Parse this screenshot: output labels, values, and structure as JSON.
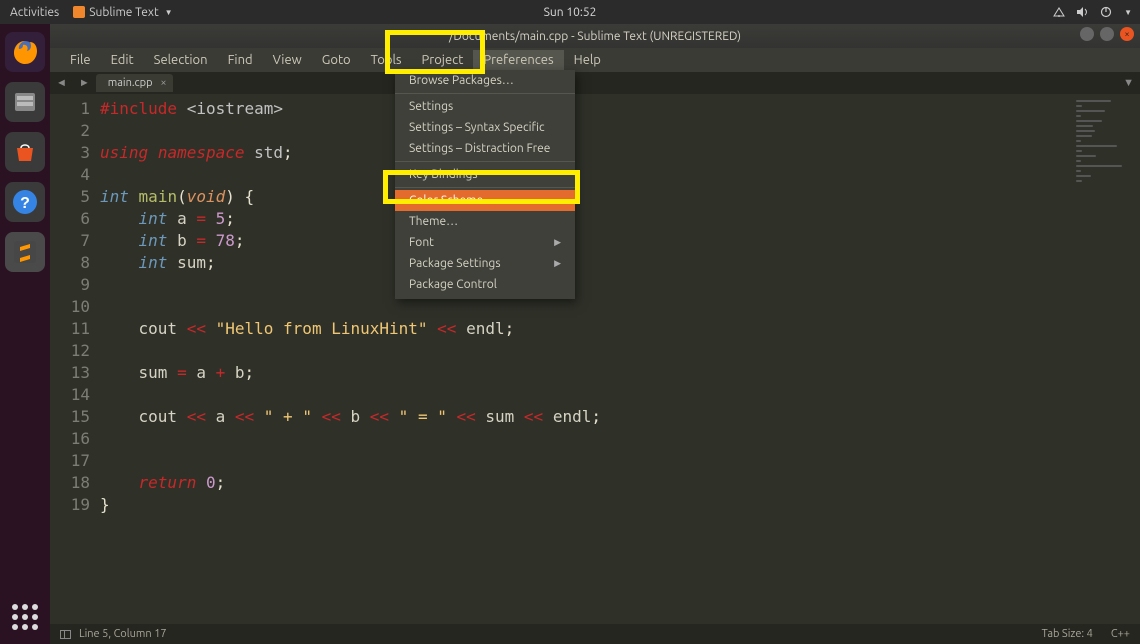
{
  "gnome": {
    "activities": "Activities",
    "app_name": "Sublime Text",
    "clock": "Sun 10:52",
    "net_icon": "network-icon",
    "sound_icon": "sound-icon",
    "power_icon": "power-icon"
  },
  "launcher": {
    "firefox": "🦊",
    "files": "🗄",
    "store": "🛍",
    "help": "?",
    "sublime": "S"
  },
  "window": {
    "title": "/Documents/main.cpp - Sublime Text (UNREGISTERED)"
  },
  "menubar": {
    "items": [
      "File",
      "Edit",
      "Selection",
      "Find",
      "View",
      "Goto",
      "Tools",
      "Project",
      "Preferences",
      "Help"
    ],
    "active_index": 8
  },
  "tabs": {
    "back": "◄",
    "fwd": "►",
    "file": "main.cpp",
    "close": "×",
    "drop": "▼"
  },
  "dropdown": {
    "items": [
      {
        "label": "Browse Packages…",
        "type": "item"
      },
      {
        "type": "sep"
      },
      {
        "label": "Settings",
        "type": "item"
      },
      {
        "label": "Settings – Syntax Specific",
        "type": "item"
      },
      {
        "label": "Settings – Distraction Free",
        "type": "item"
      },
      {
        "type": "sep"
      },
      {
        "label": "Key Bindings",
        "type": "item"
      },
      {
        "type": "sep"
      },
      {
        "label": "Color Scheme…",
        "type": "item",
        "hover": true
      },
      {
        "label": "Theme…",
        "type": "item"
      },
      {
        "label": "Font",
        "type": "item",
        "sub": true
      },
      {
        "label": "Package Settings",
        "type": "item",
        "sub": true
      },
      {
        "label": "Package Control",
        "type": "item"
      }
    ]
  },
  "code": {
    "lines": [
      {
        "n": "1",
        "frags": [
          {
            "t": "#include ",
            "c": "tok-pp"
          },
          {
            "t": "<iostream>",
            "c": "tok-inc"
          }
        ]
      },
      {
        "n": "2",
        "frags": []
      },
      {
        "n": "3",
        "frags": [
          {
            "t": "using",
            "c": "tok-key"
          },
          {
            "t": " ",
            "c": ""
          },
          {
            "t": "namespace",
            "c": "tok-key"
          },
          {
            "t": " std",
            "c": "tok-ns"
          },
          {
            "t": ";",
            "c": ""
          }
        ]
      },
      {
        "n": "4",
        "frags": []
      },
      {
        "n": "5",
        "frags": [
          {
            "t": "int",
            "c": "tok-type2"
          },
          {
            "t": " ",
            "c": ""
          },
          {
            "t": "main",
            "c": "tok-func"
          },
          {
            "t": "(",
            "c": ""
          },
          {
            "t": "void",
            "c": "tok-param"
          },
          {
            "t": ") {",
            "c": ""
          }
        ]
      },
      {
        "n": "6",
        "frags": [
          {
            "t": "    ",
            "c": ""
          },
          {
            "t": "int",
            "c": "tok-type2"
          },
          {
            "t": " a ",
            "c": "tok-id"
          },
          {
            "t": "=",
            "c": "tok-op"
          },
          {
            "t": " ",
            "c": ""
          },
          {
            "t": "5",
            "c": "tok-num"
          },
          {
            "t": ";",
            "c": ""
          }
        ]
      },
      {
        "n": "7",
        "frags": [
          {
            "t": "    ",
            "c": ""
          },
          {
            "t": "int",
            "c": "tok-type2"
          },
          {
            "t": " b ",
            "c": "tok-id"
          },
          {
            "t": "=",
            "c": "tok-op"
          },
          {
            "t": " ",
            "c": ""
          },
          {
            "t": "78",
            "c": "tok-num"
          },
          {
            "t": ";",
            "c": ""
          }
        ]
      },
      {
        "n": "8",
        "frags": [
          {
            "t": "    ",
            "c": ""
          },
          {
            "t": "int",
            "c": "tok-type2"
          },
          {
            "t": " sum",
            "c": "tok-id"
          },
          {
            "t": ";",
            "c": ""
          }
        ]
      },
      {
        "n": "9",
        "frags": []
      },
      {
        "n": "10",
        "frags": []
      },
      {
        "n": "11",
        "frags": [
          {
            "t": "    cout ",
            "c": "tok-id"
          },
          {
            "t": "<<",
            "c": "tok-op"
          },
          {
            "t": " ",
            "c": ""
          },
          {
            "t": "\"Hello from LinuxHint\"",
            "c": "tok-str"
          },
          {
            "t": " ",
            "c": ""
          },
          {
            "t": "<<",
            "c": "tok-op"
          },
          {
            "t": " endl",
            "c": "tok-id"
          },
          {
            "t": ";",
            "c": ""
          }
        ]
      },
      {
        "n": "12",
        "frags": []
      },
      {
        "n": "13",
        "frags": [
          {
            "t": "    sum ",
            "c": "tok-id"
          },
          {
            "t": "=",
            "c": "tok-op"
          },
          {
            "t": " a ",
            "c": "tok-id"
          },
          {
            "t": "+",
            "c": "tok-op"
          },
          {
            "t": " b",
            "c": "tok-id"
          },
          {
            "t": ";",
            "c": ""
          }
        ]
      },
      {
        "n": "14",
        "frags": []
      },
      {
        "n": "15",
        "frags": [
          {
            "t": "    cout ",
            "c": "tok-id"
          },
          {
            "t": "<<",
            "c": "tok-op"
          },
          {
            "t": " a ",
            "c": "tok-id"
          },
          {
            "t": "<<",
            "c": "tok-op"
          },
          {
            "t": " ",
            "c": ""
          },
          {
            "t": "\" + \"",
            "c": "tok-str"
          },
          {
            "t": " ",
            "c": ""
          },
          {
            "t": "<<",
            "c": "tok-op"
          },
          {
            "t": " b ",
            "c": "tok-id"
          },
          {
            "t": "<<",
            "c": "tok-op"
          },
          {
            "t": " ",
            "c": ""
          },
          {
            "t": "\" = \"",
            "c": "tok-str"
          },
          {
            "t": " ",
            "c": ""
          },
          {
            "t": "<<",
            "c": "tok-op"
          },
          {
            "t": " sum ",
            "c": "tok-id"
          },
          {
            "t": "<<",
            "c": "tok-op"
          },
          {
            "t": " endl",
            "c": "tok-id"
          },
          {
            "t": ";",
            "c": ""
          }
        ]
      },
      {
        "n": "16",
        "frags": []
      },
      {
        "n": "17",
        "frags": []
      },
      {
        "n": "18",
        "frags": [
          {
            "t": "    ",
            "c": ""
          },
          {
            "t": "return",
            "c": "tok-key"
          },
          {
            "t": " ",
            "c": ""
          },
          {
            "t": "0",
            "c": "tok-num"
          },
          {
            "t": ";",
            "c": ""
          }
        ]
      },
      {
        "n": "19",
        "frags": [
          {
            "t": "}",
            "c": ""
          }
        ]
      }
    ]
  },
  "status": {
    "pos": "Line 5, Column 17",
    "tab": "Tab Size: 4",
    "lang": "C++"
  }
}
